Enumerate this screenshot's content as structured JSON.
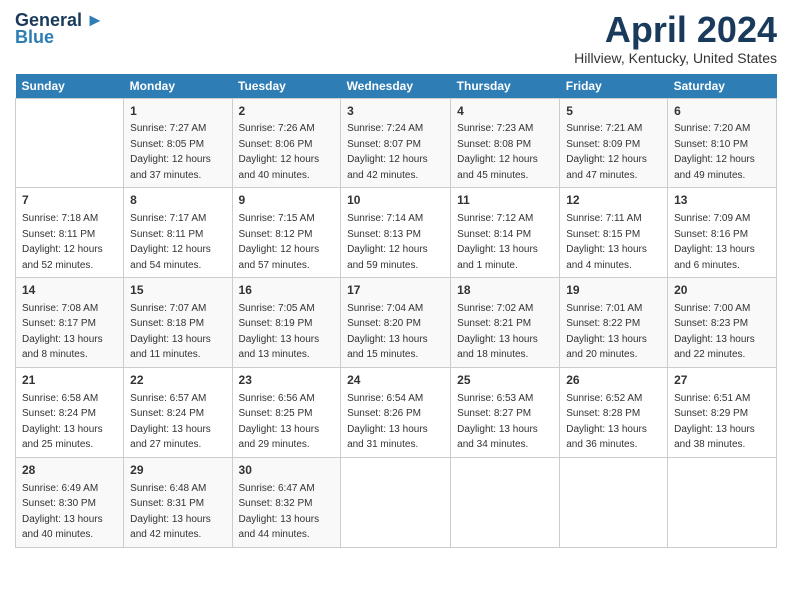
{
  "header": {
    "logo_general": "General",
    "logo_blue": "Blue",
    "title": "April 2024",
    "subtitle": "Hillview, Kentucky, United States"
  },
  "weekdays": [
    "Sunday",
    "Monday",
    "Tuesday",
    "Wednesday",
    "Thursday",
    "Friday",
    "Saturday"
  ],
  "weeks": [
    [
      {
        "day": "",
        "sunrise": "",
        "sunset": "",
        "daylight": ""
      },
      {
        "day": "1",
        "sunrise": "Sunrise: 7:27 AM",
        "sunset": "Sunset: 8:05 PM",
        "daylight": "Daylight: 12 hours and 37 minutes."
      },
      {
        "day": "2",
        "sunrise": "Sunrise: 7:26 AM",
        "sunset": "Sunset: 8:06 PM",
        "daylight": "Daylight: 12 hours and 40 minutes."
      },
      {
        "day": "3",
        "sunrise": "Sunrise: 7:24 AM",
        "sunset": "Sunset: 8:07 PM",
        "daylight": "Daylight: 12 hours and 42 minutes."
      },
      {
        "day": "4",
        "sunrise": "Sunrise: 7:23 AM",
        "sunset": "Sunset: 8:08 PM",
        "daylight": "Daylight: 12 hours and 45 minutes."
      },
      {
        "day": "5",
        "sunrise": "Sunrise: 7:21 AM",
        "sunset": "Sunset: 8:09 PM",
        "daylight": "Daylight: 12 hours and 47 minutes."
      },
      {
        "day": "6",
        "sunrise": "Sunrise: 7:20 AM",
        "sunset": "Sunset: 8:10 PM",
        "daylight": "Daylight: 12 hours and 49 minutes."
      }
    ],
    [
      {
        "day": "7",
        "sunrise": "Sunrise: 7:18 AM",
        "sunset": "Sunset: 8:11 PM",
        "daylight": "Daylight: 12 hours and 52 minutes."
      },
      {
        "day": "8",
        "sunrise": "Sunrise: 7:17 AM",
        "sunset": "Sunset: 8:11 PM",
        "daylight": "Daylight: 12 hours and 54 minutes."
      },
      {
        "day": "9",
        "sunrise": "Sunrise: 7:15 AM",
        "sunset": "Sunset: 8:12 PM",
        "daylight": "Daylight: 12 hours and 57 minutes."
      },
      {
        "day": "10",
        "sunrise": "Sunrise: 7:14 AM",
        "sunset": "Sunset: 8:13 PM",
        "daylight": "Daylight: 12 hours and 59 minutes."
      },
      {
        "day": "11",
        "sunrise": "Sunrise: 7:12 AM",
        "sunset": "Sunset: 8:14 PM",
        "daylight": "Daylight: 13 hours and 1 minute."
      },
      {
        "day": "12",
        "sunrise": "Sunrise: 7:11 AM",
        "sunset": "Sunset: 8:15 PM",
        "daylight": "Daylight: 13 hours and 4 minutes."
      },
      {
        "day": "13",
        "sunrise": "Sunrise: 7:09 AM",
        "sunset": "Sunset: 8:16 PM",
        "daylight": "Daylight: 13 hours and 6 minutes."
      }
    ],
    [
      {
        "day": "14",
        "sunrise": "Sunrise: 7:08 AM",
        "sunset": "Sunset: 8:17 PM",
        "daylight": "Daylight: 13 hours and 8 minutes."
      },
      {
        "day": "15",
        "sunrise": "Sunrise: 7:07 AM",
        "sunset": "Sunset: 8:18 PM",
        "daylight": "Daylight: 13 hours and 11 minutes."
      },
      {
        "day": "16",
        "sunrise": "Sunrise: 7:05 AM",
        "sunset": "Sunset: 8:19 PM",
        "daylight": "Daylight: 13 hours and 13 minutes."
      },
      {
        "day": "17",
        "sunrise": "Sunrise: 7:04 AM",
        "sunset": "Sunset: 8:20 PM",
        "daylight": "Daylight: 13 hours and 15 minutes."
      },
      {
        "day": "18",
        "sunrise": "Sunrise: 7:02 AM",
        "sunset": "Sunset: 8:21 PM",
        "daylight": "Daylight: 13 hours and 18 minutes."
      },
      {
        "day": "19",
        "sunrise": "Sunrise: 7:01 AM",
        "sunset": "Sunset: 8:22 PM",
        "daylight": "Daylight: 13 hours and 20 minutes."
      },
      {
        "day": "20",
        "sunrise": "Sunrise: 7:00 AM",
        "sunset": "Sunset: 8:23 PM",
        "daylight": "Daylight: 13 hours and 22 minutes."
      }
    ],
    [
      {
        "day": "21",
        "sunrise": "Sunrise: 6:58 AM",
        "sunset": "Sunset: 8:24 PM",
        "daylight": "Daylight: 13 hours and 25 minutes."
      },
      {
        "day": "22",
        "sunrise": "Sunrise: 6:57 AM",
        "sunset": "Sunset: 8:24 PM",
        "daylight": "Daylight: 13 hours and 27 minutes."
      },
      {
        "day": "23",
        "sunrise": "Sunrise: 6:56 AM",
        "sunset": "Sunset: 8:25 PM",
        "daylight": "Daylight: 13 hours and 29 minutes."
      },
      {
        "day": "24",
        "sunrise": "Sunrise: 6:54 AM",
        "sunset": "Sunset: 8:26 PM",
        "daylight": "Daylight: 13 hours and 31 minutes."
      },
      {
        "day": "25",
        "sunrise": "Sunrise: 6:53 AM",
        "sunset": "Sunset: 8:27 PM",
        "daylight": "Daylight: 13 hours and 34 minutes."
      },
      {
        "day": "26",
        "sunrise": "Sunrise: 6:52 AM",
        "sunset": "Sunset: 8:28 PM",
        "daylight": "Daylight: 13 hours and 36 minutes."
      },
      {
        "day": "27",
        "sunrise": "Sunrise: 6:51 AM",
        "sunset": "Sunset: 8:29 PM",
        "daylight": "Daylight: 13 hours and 38 minutes."
      }
    ],
    [
      {
        "day": "28",
        "sunrise": "Sunrise: 6:49 AM",
        "sunset": "Sunset: 8:30 PM",
        "daylight": "Daylight: 13 hours and 40 minutes."
      },
      {
        "day": "29",
        "sunrise": "Sunrise: 6:48 AM",
        "sunset": "Sunset: 8:31 PM",
        "daylight": "Daylight: 13 hours and 42 minutes."
      },
      {
        "day": "30",
        "sunrise": "Sunrise: 6:47 AM",
        "sunset": "Sunset: 8:32 PM",
        "daylight": "Daylight: 13 hours and 44 minutes."
      },
      {
        "day": "",
        "sunrise": "",
        "sunset": "",
        "daylight": ""
      },
      {
        "day": "",
        "sunrise": "",
        "sunset": "",
        "daylight": ""
      },
      {
        "day": "",
        "sunrise": "",
        "sunset": "",
        "daylight": ""
      },
      {
        "day": "",
        "sunrise": "",
        "sunset": "",
        "daylight": ""
      }
    ]
  ]
}
